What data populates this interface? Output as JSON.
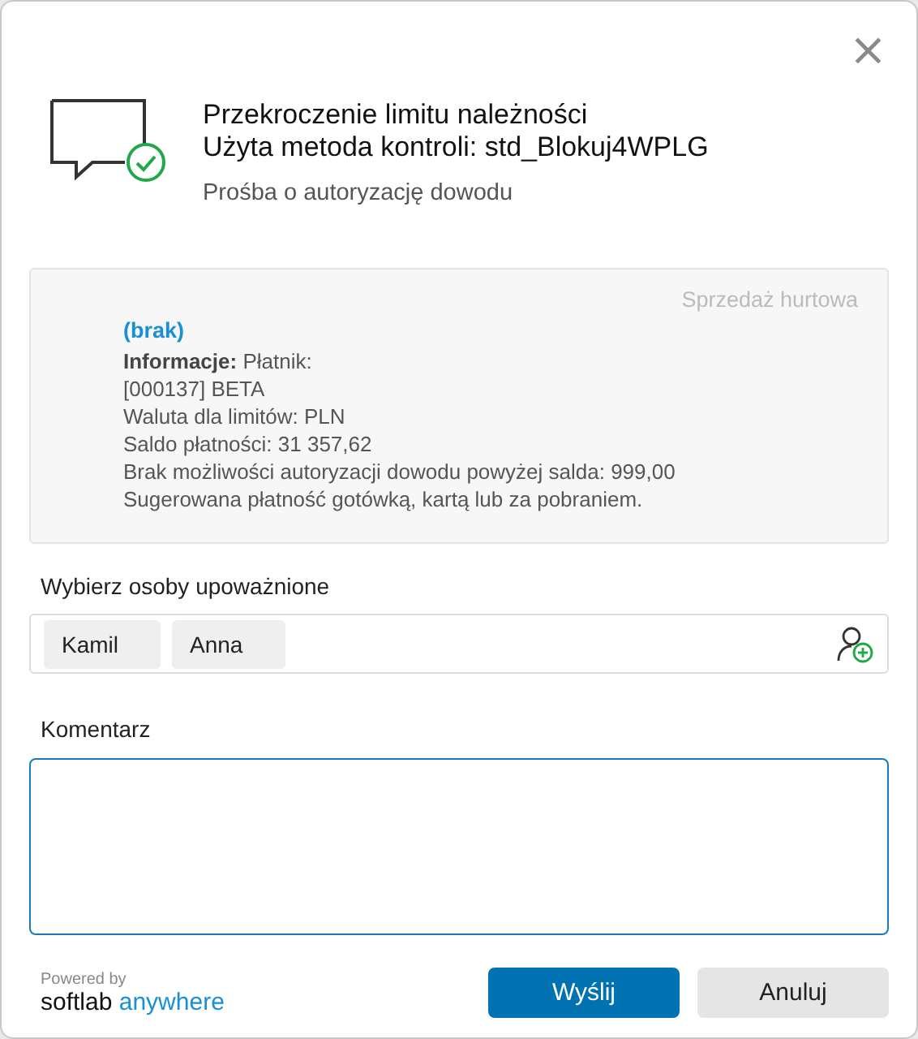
{
  "dialog": {
    "title_lines": [
      "Przekroczenie limitu należności",
      "Użyta metoda kontroli: std_Blokuj4WPLG"
    ],
    "subtitle": "Prośba o autoryzację dowodu",
    "close": "×"
  },
  "info": {
    "category": "Sprzedaż hurtowa",
    "link": "(brak)",
    "lines": [
      "**Informacje:** Płatnik:",
      "[000137] BETA",
      "Waluta dla limitów: PLN",
      "Saldo płatności: 31 357,62",
      "Brak możliwości autoryzacji dowodu powyżej salda: 999,00",
      "Sugerowana płatność gotówką, kartą lub za pobraniem."
    ]
  },
  "approvers": {
    "label": "Wybierz osoby upoważnione",
    "people": [
      "Kamil",
      "Anna"
    ]
  },
  "comment": {
    "label": "Komentarz"
  },
  "footer": {
    "powered_by": "Powered by",
    "brand": [
      "softlab",
      "anywhere"
    ],
    "buttons": [
      {
        "label": "Wyślij",
        "kind": "primary"
      },
      {
        "label": "Anuluj",
        "kind": "secondary"
      }
    ]
  }
}
